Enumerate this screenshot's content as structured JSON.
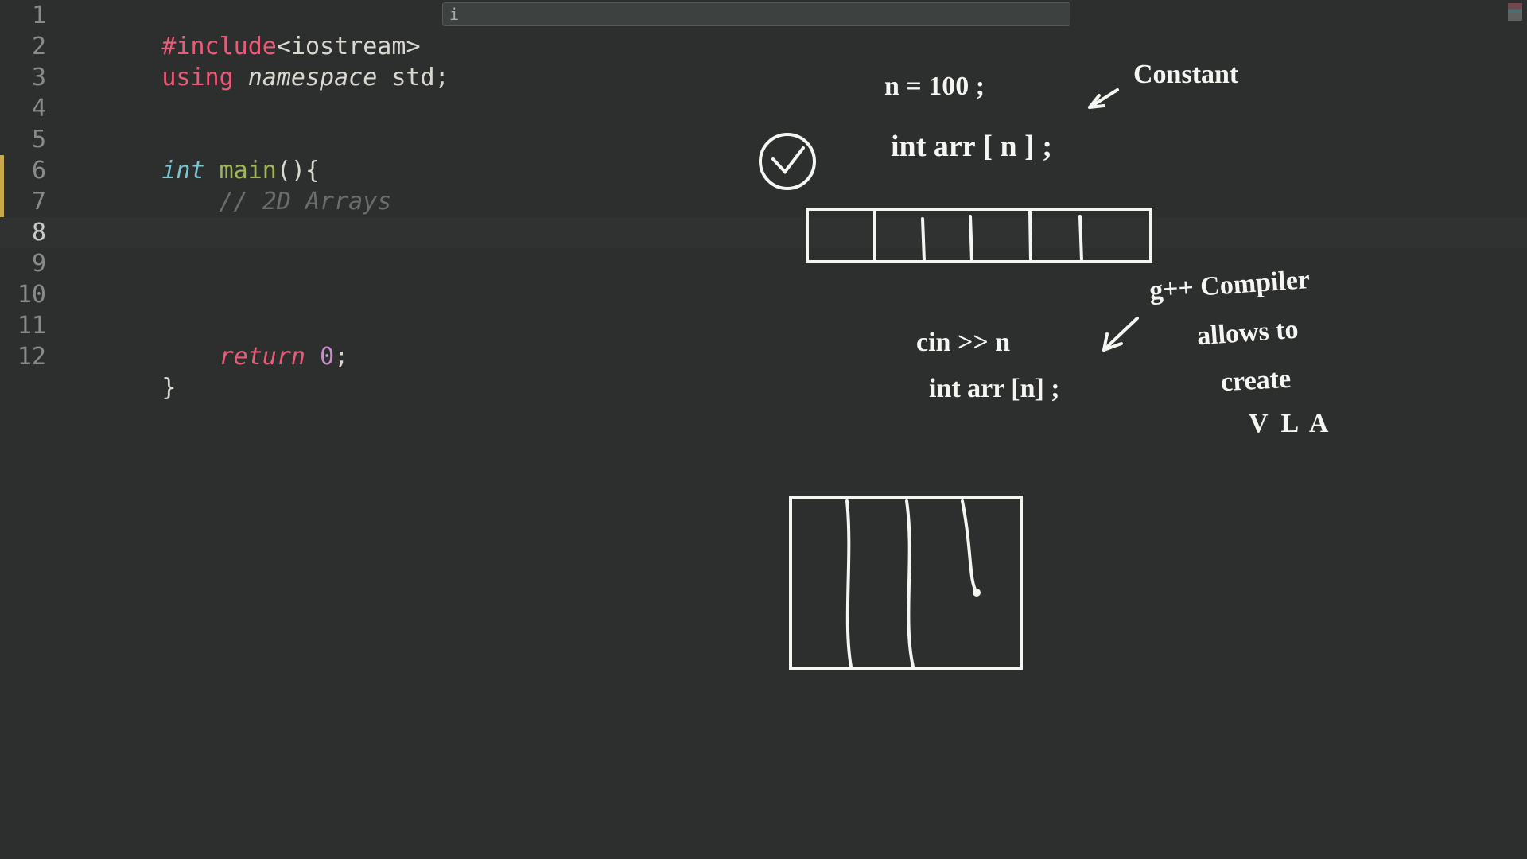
{
  "editor": {
    "lines": [
      {
        "n": "1"
      },
      {
        "n": "2"
      },
      {
        "n": "3"
      },
      {
        "n": "4"
      },
      {
        "n": "5"
      },
      {
        "n": "6"
      },
      {
        "n": "7"
      },
      {
        "n": "8"
      },
      {
        "n": "9"
      },
      {
        "n": "10"
      },
      {
        "n": "11"
      },
      {
        "n": "12"
      }
    ],
    "active_line_index": 7,
    "code": {
      "l1_include": "#include",
      "l1_ang_open": "<",
      "l1_lib": "iostream",
      "l1_ang_close": ">",
      "l2_using": "using",
      "l2_namespace": " namespace ",
      "l2_std": "std",
      "l2_semi": ";",
      "l5_int": "int ",
      "l5_main": "main",
      "l5_paren": "()",
      "l5_brace": "{",
      "l6_comment": "    // 2D Arrays",
      "l11_return": "    return ",
      "l11_zero": "0",
      "l11_semi": ";",
      "l12_close": "}"
    }
  },
  "hint": {
    "text": "i"
  },
  "annotations": {
    "n_100": "n = 100 ;",
    "constant": "Constant",
    "int_arr_n_1": "int   arr [ n ]  ;",
    "cin_n": "cin >> n",
    "int_arr_n_2": "int  arr [n] ;",
    "gpp": "g++ Compiler",
    "allows": "allows to",
    "create": "create",
    "vla": "V L A"
  }
}
